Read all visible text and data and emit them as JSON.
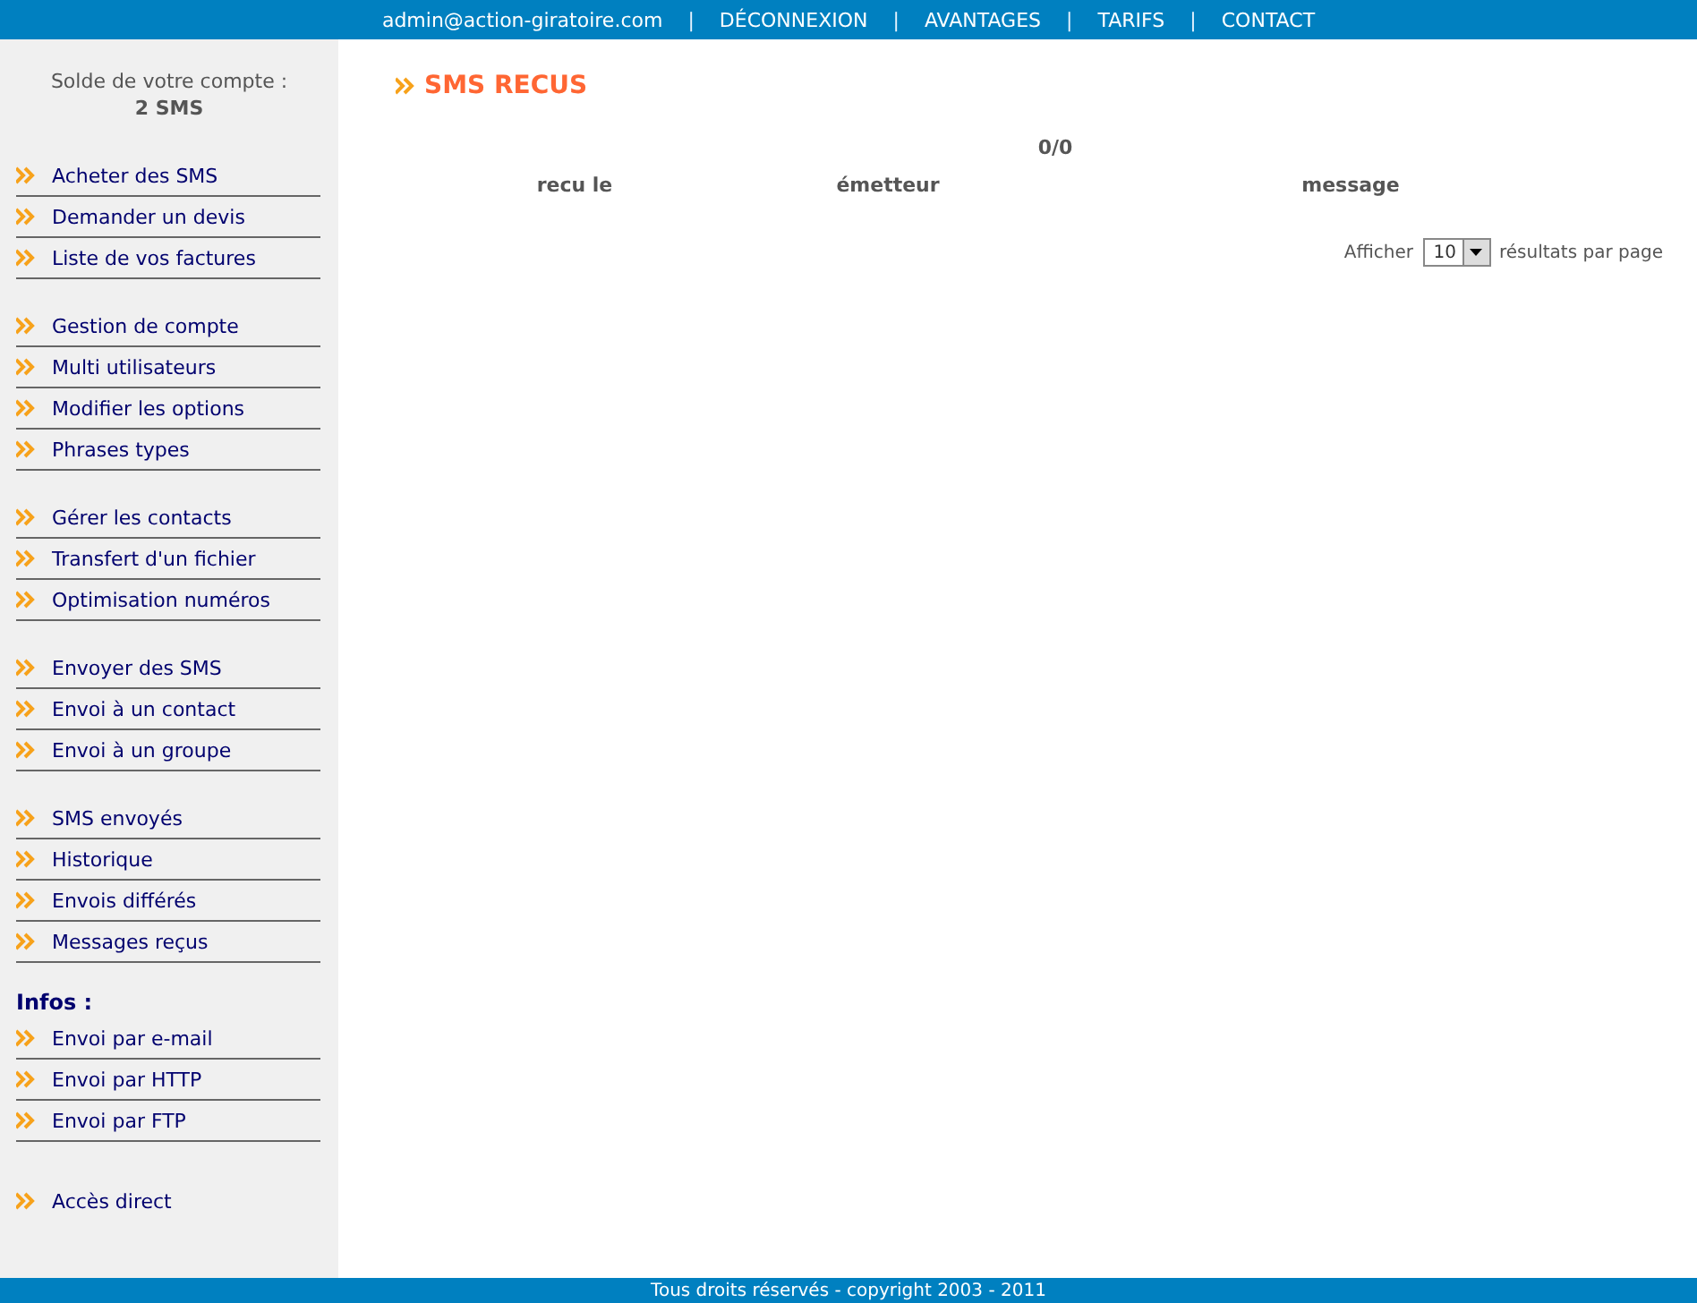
{
  "top_bar": {
    "items": [
      {
        "kind": "link",
        "text": "admin@action-giratoire.com"
      },
      {
        "kind": "separator",
        "text": "|"
      },
      {
        "kind": "link",
        "text": "DÉCONNEXION"
      },
      {
        "kind": "separator",
        "text": "|"
      },
      {
        "kind": "link",
        "text": "AVANTAGES"
      },
      {
        "kind": "separator",
        "text": "|"
      },
      {
        "kind": "link",
        "text": "TARIFS"
      },
      {
        "kind": "separator",
        "text": "|"
      },
      {
        "kind": "link",
        "text": "CONTACT"
      }
    ]
  },
  "sidebar": {
    "balance_label": "Solde de votre compte :",
    "balance_value": "2 SMS",
    "groups": [
      {
        "items": [
          {
            "kind": "menu",
            "label": "Acheter des SMS"
          },
          {
            "kind": "menu",
            "label": "Demander un devis"
          },
          {
            "kind": "menu",
            "label": "Liste de vos factures"
          }
        ]
      },
      {
        "items": [
          {
            "kind": "menu",
            "label": "Gestion de compte"
          },
          {
            "kind": "menu",
            "label": "Multi utilisateurs"
          },
          {
            "kind": "menu",
            "label": "Modifier les options"
          },
          {
            "kind": "menu",
            "label": "Phrases types"
          }
        ]
      },
      {
        "items": [
          {
            "kind": "menu",
            "label": "Gérer les contacts"
          },
          {
            "kind": "menu",
            "label": "Transfert d'un fichier"
          },
          {
            "kind": "menu",
            "label": "Optimisation numéros"
          }
        ]
      },
      {
        "items": [
          {
            "kind": "menu",
            "label": "Envoyer des SMS"
          },
          {
            "kind": "menu",
            "label": "Envoi à un contact"
          },
          {
            "kind": "menu",
            "label": "Envoi à un groupe"
          }
        ]
      },
      {
        "items": [
          {
            "kind": "menu",
            "label": "SMS envoyés"
          },
          {
            "kind": "menu",
            "label": "Historique"
          },
          {
            "kind": "menu",
            "label": "Envois différés"
          },
          {
            "kind": "menu",
            "label": "Messages reçus"
          }
        ]
      },
      {
        "heading": "Infos :",
        "items": [
          {
            "kind": "menu",
            "label": "Envoi par e-mail"
          },
          {
            "kind": "menu",
            "label": "Envoi par HTTP"
          },
          {
            "kind": "menu",
            "label": "Envoi par FTP"
          }
        ]
      },
      {
        "items": [
          {
            "kind": "link",
            "label": "Accès direct"
          }
        ]
      }
    ]
  },
  "main": {
    "title": "SMS RECUS",
    "count": "0/0",
    "table": {
      "columns": [
        "recu le",
        "émetteur",
        "message"
      ]
    },
    "pager": {
      "label_before": "Afficher",
      "value": "10",
      "label_after": "résultats par page"
    }
  },
  "footer": {
    "text": "Tous droits réservés - copyright 2003 - 2011"
  }
}
